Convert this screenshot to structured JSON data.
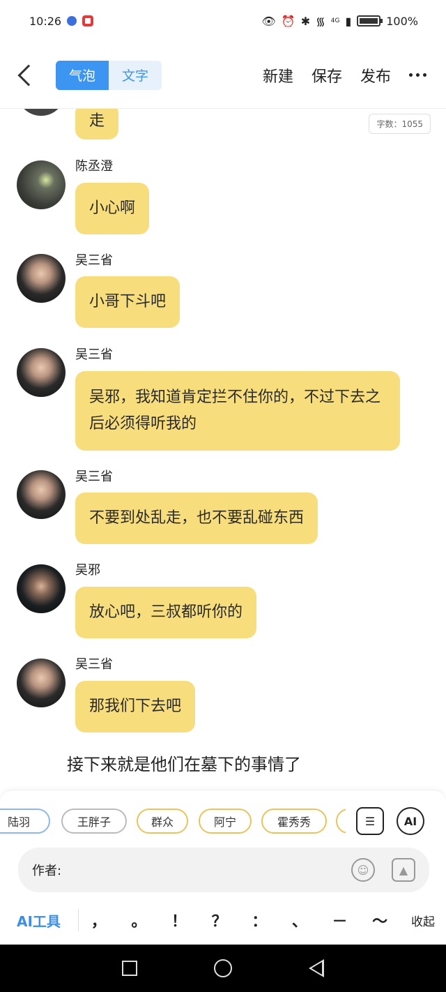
{
  "status_bar": {
    "time": "10:26",
    "battery": "100%",
    "network": "4G"
  },
  "header": {
    "mode_bubble": "气泡",
    "mode_text": "文字",
    "new_label": "新建",
    "save_label": "保存",
    "publish_label": "发布"
  },
  "chat": {
    "word_count": "字数：1055",
    "top_partial_bubble": "走",
    "messages": [
      {
        "name": "陈丞澄",
        "text": "小心啊"
      },
      {
        "name": "吴三省",
        "text": "小哥下斗吧"
      },
      {
        "name": "吴三省",
        "text": "吴邪，我知道肯定拦不住你的，不过下去之后必须得听我的"
      },
      {
        "name": "吴三省",
        "text": "不要到处乱走，也不要乱碰东西"
      },
      {
        "name": "吴邪",
        "text": "放心吧，三叔都听你的"
      },
      {
        "name": "吴三省",
        "text": "那我们下去吧"
      }
    ],
    "narration": "接下来就是他们在墓下的事情了"
  },
  "panel": {
    "characters": [
      "陆羽",
      "王胖子",
      "群众",
      "阿宁",
      "霍秀秀"
    ],
    "ai_badge": "AI",
    "author_label": "作者:",
    "ai_tools_label": "AI工具",
    "punctuation": [
      "，",
      "。",
      "！",
      "？",
      "：",
      "、",
      "－",
      "～"
    ],
    "collapse_label": "收起"
  },
  "colors": {
    "accent": "#3c95f0",
    "bubble": "#f8dd7d"
  }
}
